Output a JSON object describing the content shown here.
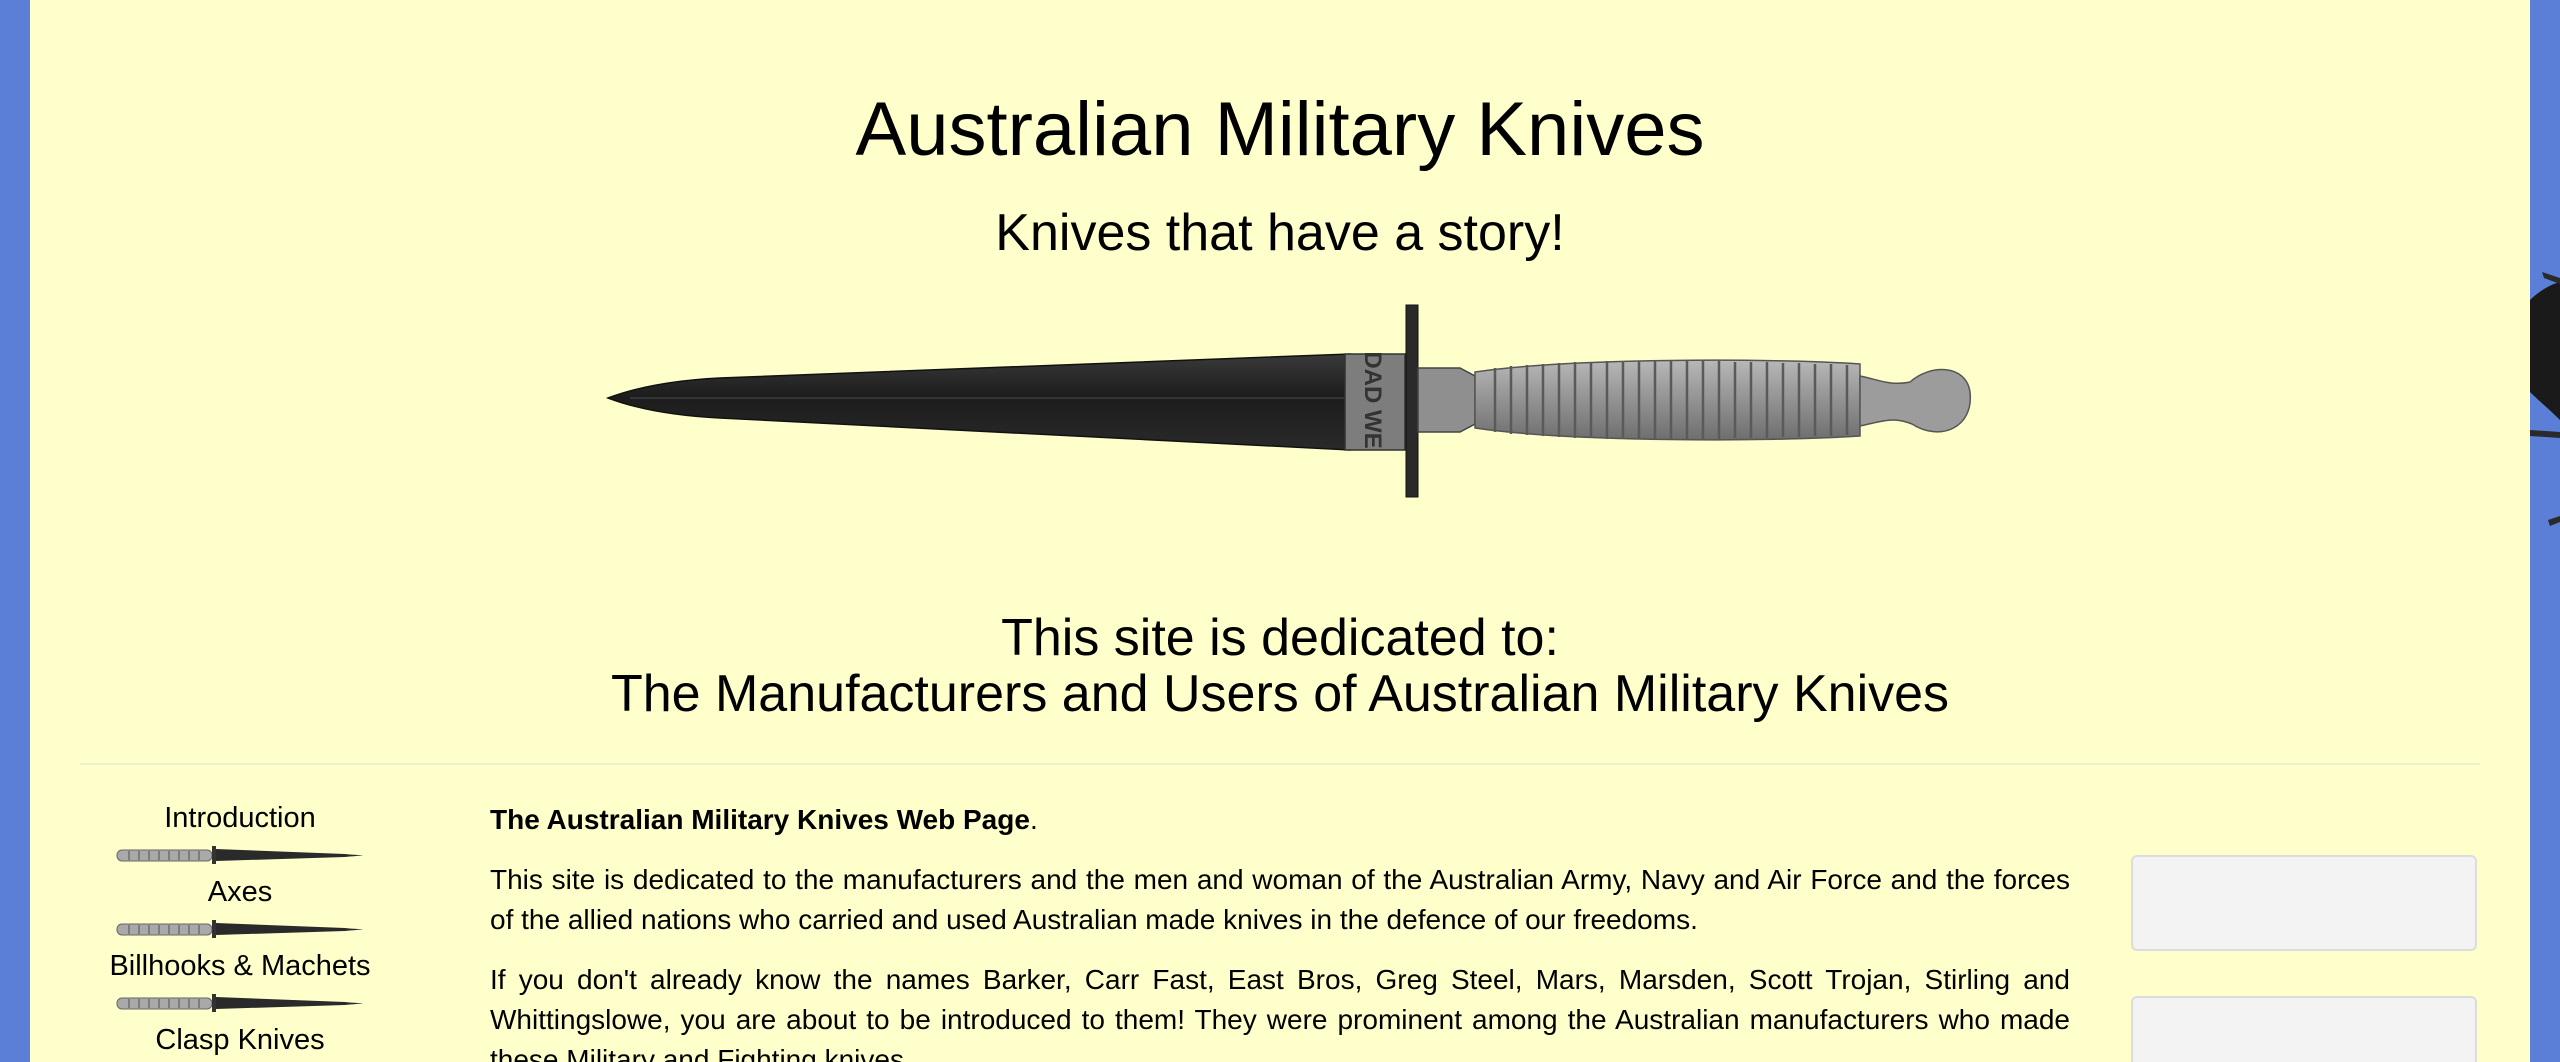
{
  "header": {
    "title": "Australian Military Knives",
    "subtitle": "Knives that have a story!",
    "knife_inscription": "DAD WE",
    "dedication_line1": "This site is dedicated to:",
    "dedication_line2": "The Manufacturers and Users of Australian Military Knives"
  },
  "sidebar": {
    "items": [
      {
        "label": "Introduction"
      },
      {
        "label": "Axes"
      },
      {
        "label": "Billhooks & Machets"
      },
      {
        "label": "Clasp Knives"
      }
    ]
  },
  "main": {
    "intro_title": "The Australian Military Knives Web Page",
    "intro_title_suffix": ".",
    "paragraph1": "This site is dedicated to the manufacturers and the men and woman of the Australian Army, Navy and Air Force and the forces of the allied nations who carried and used Australian made knives in the defence of our freedoms.",
    "paragraph2": "If you don't already know the names Barker, Carr Fast, East Bros, Greg Steel, Mars, Marsden, Scott Trojan, Stirling and Whittingslowe, you are about to be introduced to them! They were prominent among the Australian manufacturers who made these Military and Fighting knives."
  },
  "colors": {
    "page_background": "#ffffcc",
    "outer_background": "#5b7fd6",
    "side_box": "#f3f3f3"
  }
}
